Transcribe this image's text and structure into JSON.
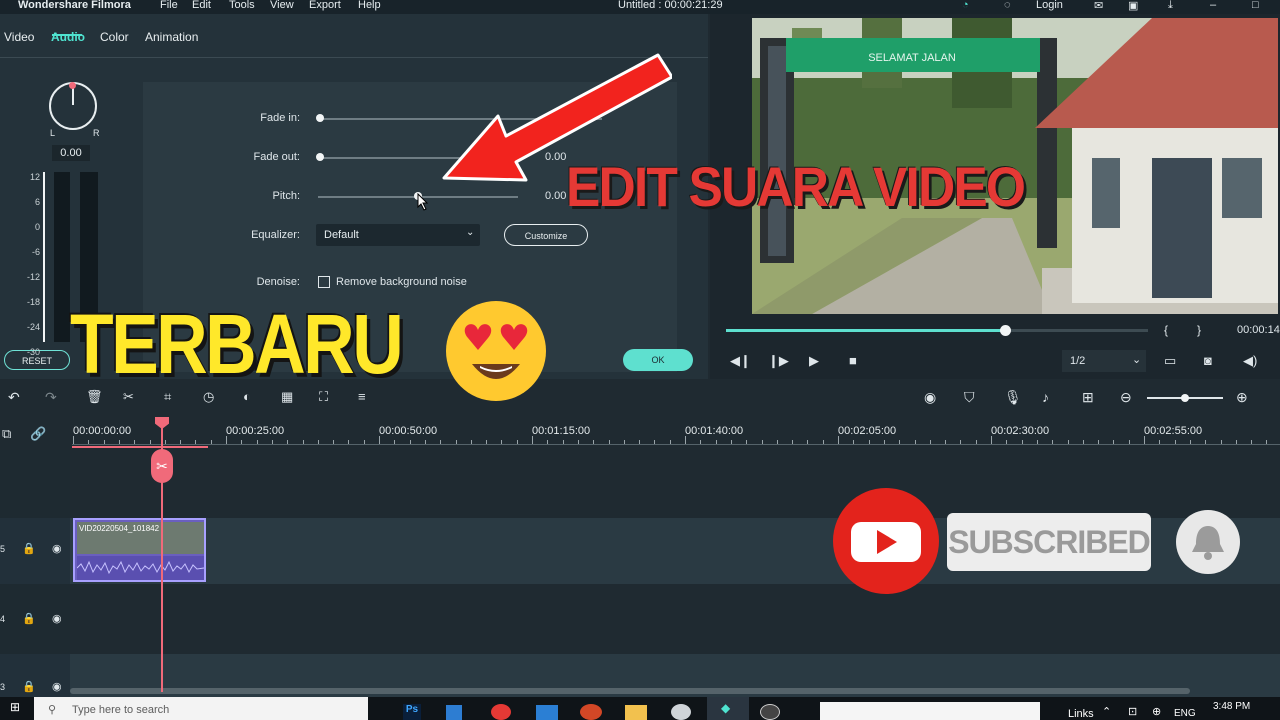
{
  "app": {
    "title": "Wondershare Filmora",
    "menu": [
      "File",
      "Edit",
      "Tools",
      "View",
      "Export",
      "Help"
    ],
    "project_title": "Untitled : 00:00:21:29",
    "login": "Login"
  },
  "tabs": [
    "Video",
    "Audio",
    "Color",
    "Animation"
  ],
  "audio": {
    "balance_value": "0.00",
    "balance_left": "L",
    "balance_right": "R",
    "fade_in_label": "Fade in:",
    "fade_out_label": "Fade out:",
    "fade_out_value": "0.00",
    "pitch_label": "Pitch:",
    "pitch_value": "0.00",
    "equalizer_label": "Equalizer:",
    "equalizer_value": "Default",
    "customize_label": "Customize",
    "denoise_label": "Denoise:",
    "denoise_option": "Remove background noise",
    "reset_label": "RESET",
    "ok_label": "OK",
    "meter_ticks": [
      "12",
      "6",
      "0",
      "-6",
      "-12",
      "-18",
      "-24",
      "-30"
    ]
  },
  "preview": {
    "time": "00:00:14",
    "quality": "1/2",
    "progress": 0.66,
    "sign_text": "SELAMAT JALAN"
  },
  "timeline": {
    "ruler": [
      "00:00:00:00",
      "00:00:25:00",
      "00:00:50:00",
      "00:01:15:00",
      "00:01:40:00",
      "00:02:05:00",
      "00:02:30:00",
      "00:02:55:00"
    ],
    "clip_label": "VID20220504_101842",
    "tracks": [
      "5",
      "4",
      "3"
    ]
  },
  "overlay": {
    "headline": "EDIT SUARA VIDEO",
    "subheadline": "TERBARU",
    "subscribe": "SUBSCRIBED"
  },
  "taskbar": {
    "search_placeholder": "Type here to search",
    "links": "Links",
    "lang": "ENG",
    "clock": "3:48 PM"
  },
  "colors": {
    "accent": "#4fe3d0",
    "playhead": "#f06a7a",
    "headline": "#e53935",
    "subheadline": "#ffe82a"
  }
}
